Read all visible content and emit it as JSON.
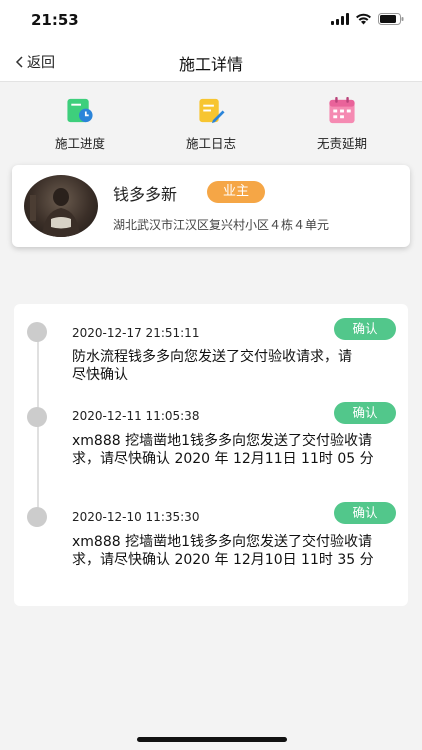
{
  "status_bar": {
    "time": "21:53"
  },
  "nav": {
    "back_label": "返回",
    "title": "施工详情"
  },
  "quick_actions": [
    {
      "label": "施工进度",
      "icon": "progress-icon"
    },
    {
      "label": "施工日志",
      "icon": "log-icon"
    },
    {
      "label": "无责延期",
      "icon": "calendar-icon"
    }
  ],
  "user": {
    "name": "钱多多新",
    "role": "业主",
    "address": "湖北武汉市江汉区复兴村小区４栋４单元"
  },
  "timeline": [
    {
      "time": "2020-12-17 21:51:11",
      "text": "防水流程钱多多向您发送了交付验收请求，请尽快确认",
      "button": "确认"
    },
    {
      "time": "2020-12-11 11:05:38",
      "text": "xm888 挖墙凿地1钱多多向您发送了交付验收请求，请尽快确认 2020 年 12月11日 11时 05 分",
      "button": "确认"
    },
    {
      "time": "2020-12-10 11:35:30",
      "text": "xm888 挖墙凿地1钱多多向您发送了交付验收请求，请尽快确认 2020 年 12月10日 11时 35 分",
      "button": "确认"
    }
  ],
  "colors": {
    "accent_green": "#52c78b",
    "badge_orange": "#f5a646",
    "background": "#f3f3f3"
  }
}
